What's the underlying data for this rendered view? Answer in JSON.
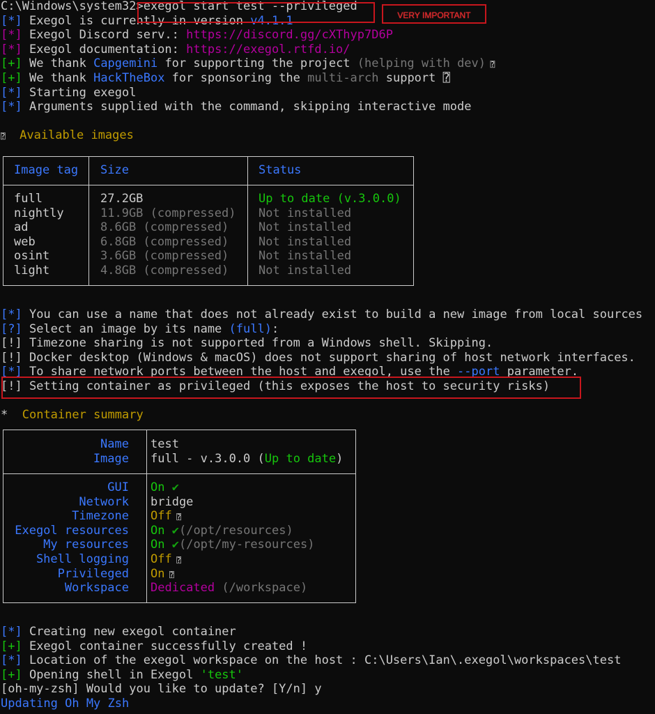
{
  "prompt": "C:\\Windows\\system32",
  "command": ">exegol start test --privileged",
  "annotation_label": "VERY IMPORTANT",
  "header": {
    "l1_pre": "[*] Exegol is currently in version ",
    "l1_ver": "v4.1.1",
    "l2_pre": "[*] Exegol Discord serv.: ",
    "l2_url": "https://discord.gg/cXThyp7D6P",
    "l3_pre": "[*] Exegol documentation: ",
    "l3_url": "https://exegol.rtfd.io/",
    "l4_a": "[+] We thank ",
    "l4_b": "Capgemini",
    "l4_c": " for supporting the project ",
    "l4_d": "(helping with dev)",
    "l4_e": " ⍰",
    "l5_a": "[+] We thank ",
    "l5_b": "HackTheBox",
    "l5_c": " for sponsoring the ",
    "l5_d": "multi-arch",
    "l5_e": " support ⍰",
    "l6": "[*] Starting exegol",
    "l7": "[*] Arguments supplied with the command, skipping interactive mode"
  },
  "images_section": {
    "icon": "⍰",
    "title": "Available images",
    "columns": [
      "Image tag",
      "Size",
      "Status"
    ],
    "rows": [
      {
        "tag": "full",
        "size": "27.2GB",
        "size_note": "",
        "status": "Up to date (v.3.0.0)"
      },
      {
        "tag": "nightly",
        "size": "11.9GB",
        "size_note": " (compressed)",
        "status": "Not installed"
      },
      {
        "tag": "ad",
        "size": "8.6GB",
        "size_note": " (compressed)",
        "status": "Not installed"
      },
      {
        "tag": "web",
        "size": "6.8GB",
        "size_note": " (compressed)",
        "status": "Not installed"
      },
      {
        "tag": "osint",
        "size": "3.6GB",
        "size_note": " (compressed)",
        "status": "Not installed"
      },
      {
        "tag": "light",
        "size": "4.8GB",
        "size_note": " (compressed)",
        "status": "Not installed"
      }
    ]
  },
  "mid": {
    "m1": "[*] You can use a name that does not already exist to build a new image from local sources",
    "m2_a": "[?] Select an image by its name ",
    "m2_b": "(full)",
    "m2_c": ":",
    "m3": "[!] Timezone sharing is not supported from a Windows shell. Skipping.",
    "m4": "[!] Docker desktop (Windows & macOS) does not support sharing of host network interfaces.",
    "m5_a": "[*] To share network ports between the host and exegol, use the ",
    "m5_b": "--port",
    "m5_c": " parameter.",
    "m6": "[!] Setting container as privileged (this exposes the host to security risks)"
  },
  "summary_section": {
    "icon": "*",
    "title": "Container summary",
    "name_label": "Name",
    "name_value": "test",
    "image_label": "Image",
    "image_value_a": "full - v.3.0.0 (",
    "image_value_b": "Up to date",
    "image_value_c": ")",
    "rows": [
      {
        "label": "GUI",
        "value": "On",
        "extra": " ✔",
        "path": ""
      },
      {
        "label": "Network",
        "value": "bridge",
        "extra": "",
        "path": ""
      },
      {
        "label": "Timezone",
        "value": "Off",
        "extra": " ⍰",
        "path": ""
      },
      {
        "label": "Exegol resources",
        "value": "On",
        "extra": " ✔",
        "path": "(/opt/resources)"
      },
      {
        "label": "My resources",
        "value": "On",
        "extra": " ✔",
        "path": "(/opt/my-resources)"
      },
      {
        "label": "Shell logging",
        "value": "Off",
        "extra": " ⍰",
        "path": ""
      },
      {
        "label": "Privileged",
        "value": "On",
        "extra": " ⍰",
        "path": ""
      },
      {
        "label": "Workspace",
        "value": "Dedicated",
        "extra": "",
        "path": " (/workspace)"
      }
    ]
  },
  "footer": {
    "f1": "[*] Creating new exegol container",
    "f2": "[+] Exegol container successfully created !",
    "f3": "[*] Location of the exegol workspace on the host : C:\\Users\\Ian\\.exegol\\workspaces\\test",
    "f4_a": "[+] Opening shell in Exegol ",
    "f4_b": "'test'",
    "f5": "[oh-my-zsh] Would you like to update? [Y/n] y",
    "f6": "Updating Oh My Zsh"
  }
}
